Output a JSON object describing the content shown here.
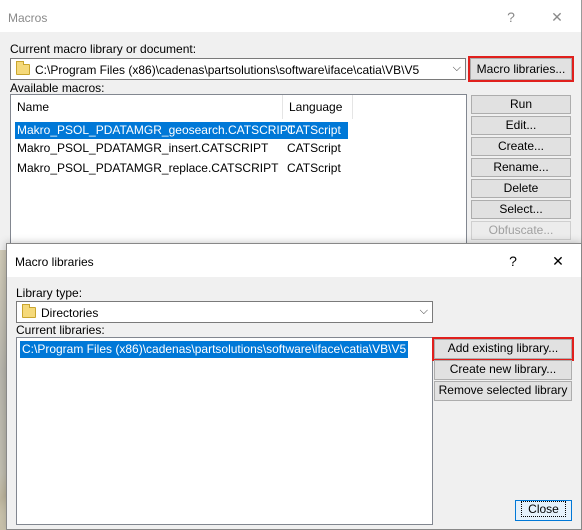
{
  "macros_window": {
    "title": "Macros",
    "help": "?",
    "close": "✕",
    "library_label": "Current macro library or document:",
    "library_path": "C:\\Program Files (x86)\\cadenas\\partsolutions\\software\\iface\\catia\\VB\\V5",
    "macro_libraries_button": "Macro libraries...",
    "available_label": "Available macros:",
    "columns": {
      "name": "Name",
      "language": "Language"
    },
    "macros": [
      {
        "name": "Makro_PSOL_PDATAMGR_geosearch.CATSCRIPT",
        "language": "CATScript",
        "selected": true
      },
      {
        "name": "Makro_PSOL_PDATAMGR_insert.CATSCRIPT",
        "language": "CATScript",
        "selected": false
      },
      {
        "name": "Makro_PSOL_PDATAMGR_replace.CATSCRIPT",
        "language": "CATScript",
        "selected": false
      }
    ],
    "buttons": {
      "run": "Run",
      "edit": "Edit...",
      "create": "Create...",
      "rename": "Rename...",
      "delete": "Delete",
      "select": "Select...",
      "obfuscate": "Obfuscate..."
    }
  },
  "libraries_window": {
    "title": "Macro libraries",
    "help": "?",
    "close": "✕",
    "type_label": "Library type:",
    "type_value": "Directories",
    "current_label": "Current libraries:",
    "libraries": [
      "C:\\Program Files (x86)\\cadenas\\partsolutions\\software\\iface\\catia\\VB\\V5"
    ],
    "buttons": {
      "add_existing": "Add existing library...",
      "create_new": "Create new library...",
      "remove_selected": "Remove selected library",
      "close": "Close"
    }
  }
}
